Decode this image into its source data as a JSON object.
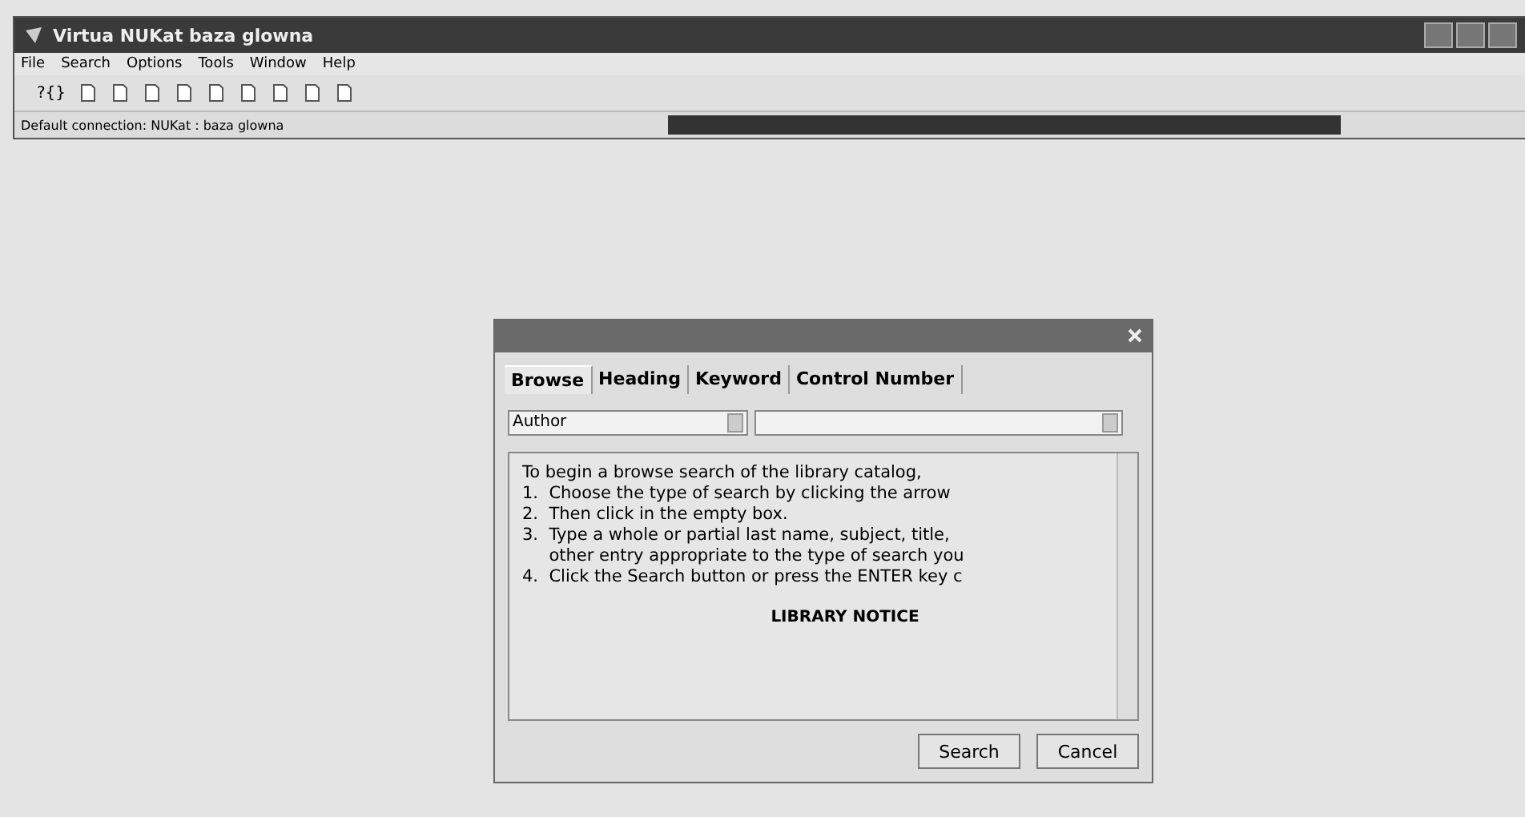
{
  "window": {
    "title": "Virtua  NUKat  baza glowna"
  },
  "menu": [
    "File",
    "Search",
    "Options",
    "Tools",
    "Window",
    "Help"
  ],
  "toolbar": {
    "help_text": "?{}"
  },
  "status_bar": "Default connection: NUKat : baza glowna",
  "dialog": {
    "tabs": [
      {
        "label": "Browse",
        "selected": true
      },
      {
        "label": "Heading",
        "selected": false
      },
      {
        "label": "Keyword",
        "selected": false
      },
      {
        "label": "Control Number",
        "selected": false
      }
    ],
    "type_select": {
      "value": "Author"
    },
    "instructions": [
      "To begin a browse search of the library catalog,",
      "1.  Choose the type of search by clicking the arrow",
      "2.  Then click in the empty box.",
      "3.  Type a whole or partial last name, subject, title,",
      "     other entry appropriate to the type of search you",
      "4.  Click the Search button or press the ENTER key c"
    ],
    "notice": "LIBRARY NOTICE",
    "buttons": [
      "Search",
      "Cancel"
    ]
  }
}
